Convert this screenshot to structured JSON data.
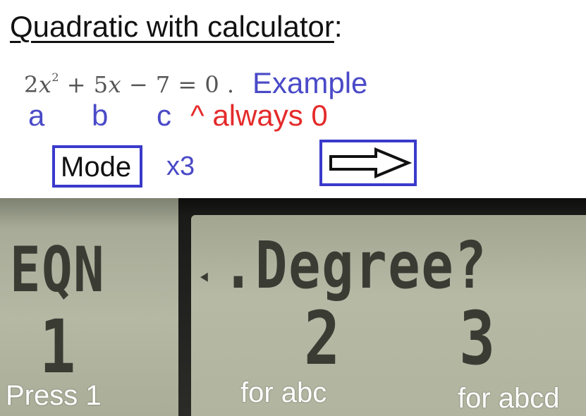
{
  "title": {
    "main": "Quadratic with calculator",
    "colon": ":"
  },
  "equation": {
    "coef_a": "2",
    "var1": "x",
    "exp": "2",
    "op1": " + 5",
    "var2": "x",
    "op2": " − 7 = 0 ."
  },
  "example_label": "Example",
  "coefficients": {
    "a": "a",
    "b": "b",
    "c": "c",
    "note": "^ always 0"
  },
  "mode": {
    "label": "Mode",
    "times": "x3"
  },
  "arrow_icon": "right-arrow-icon",
  "lcd": {
    "left": {
      "line1": "EQN",
      "line2": "1"
    },
    "right": {
      "indicator": "◂",
      "line1": ".Degree?",
      "opt2": "2",
      "opt3": "3"
    }
  },
  "captions": {
    "press": "Press 1",
    "abc": "for abc",
    "abcd": "for abcd"
  },
  "colors": {
    "blue": "#4a4ac8",
    "red": "#e52a2a",
    "box_border": "#3a3acc"
  }
}
